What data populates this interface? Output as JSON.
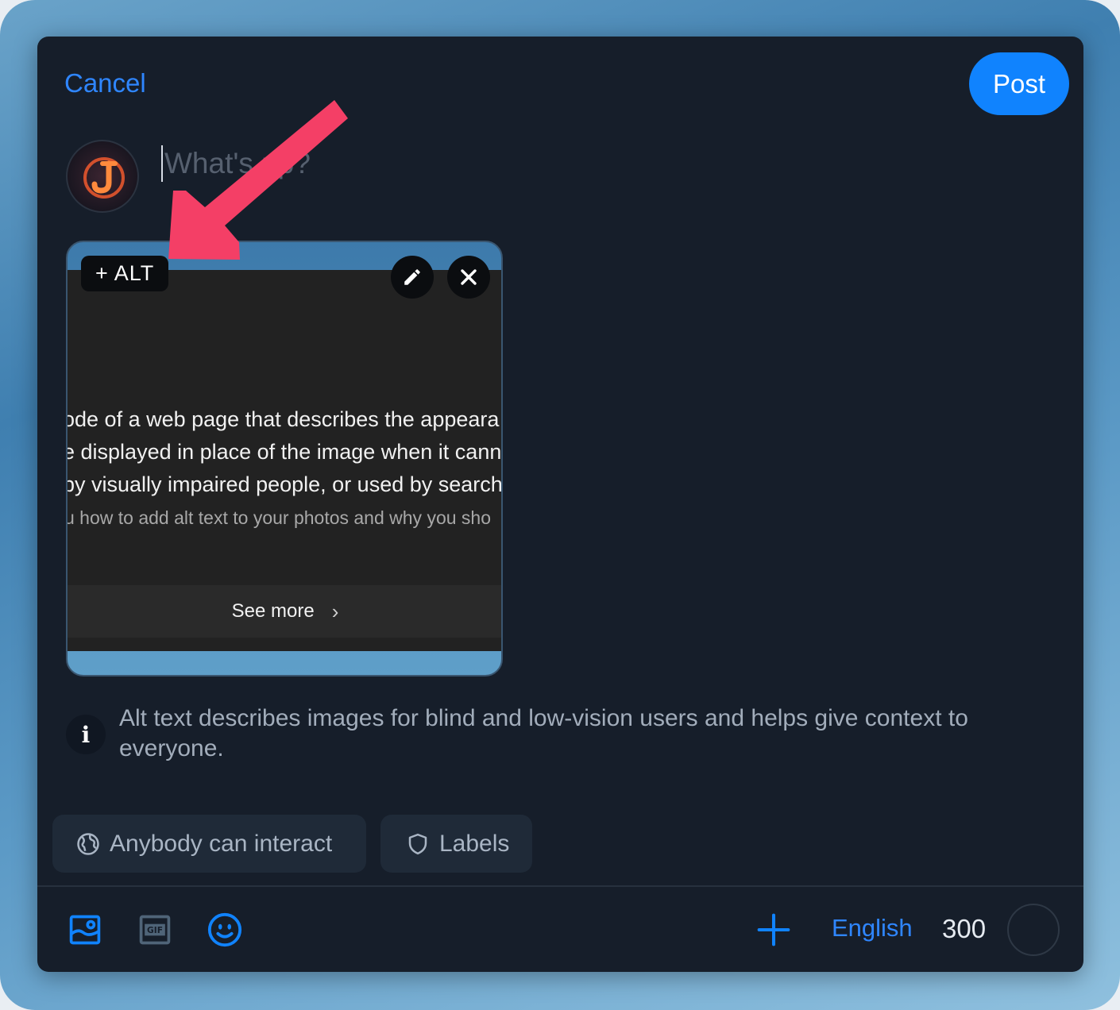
{
  "header": {
    "cancel_label": "Cancel",
    "post_label": "Post"
  },
  "composer": {
    "placeholder": "What's up?"
  },
  "media": {
    "alt_label": "+ ALT",
    "screenshot_lines": [
      "ode of a web page that describes the appeara",
      "e displayed in place of the image when it canno",
      "by visually impaired people, or used by search",
      "u how to add alt text to your photos and why you sho"
    ],
    "see_more_label": "See more"
  },
  "info": {
    "text": "Alt text describes images for blind and low-vision users and helps give context to everyone."
  },
  "controls": {
    "interact_label": "Anybody can interact",
    "labels_label": "Labels"
  },
  "footer": {
    "language": "English",
    "char_count": "300"
  },
  "icons": {
    "image": "image-icon",
    "gif": "gif-icon",
    "emoji": "emoji-icon",
    "add": "plus-icon",
    "edit": "pencil-icon",
    "remove": "close-icon",
    "info": "info-icon",
    "globe": "globe-icon",
    "shield": "shield-icon",
    "annotation": "arrow-annotation"
  },
  "colors": {
    "accent": "#1083fe",
    "link": "#2f86ff",
    "background": "#161e2a",
    "annotation": "#f43f66"
  }
}
